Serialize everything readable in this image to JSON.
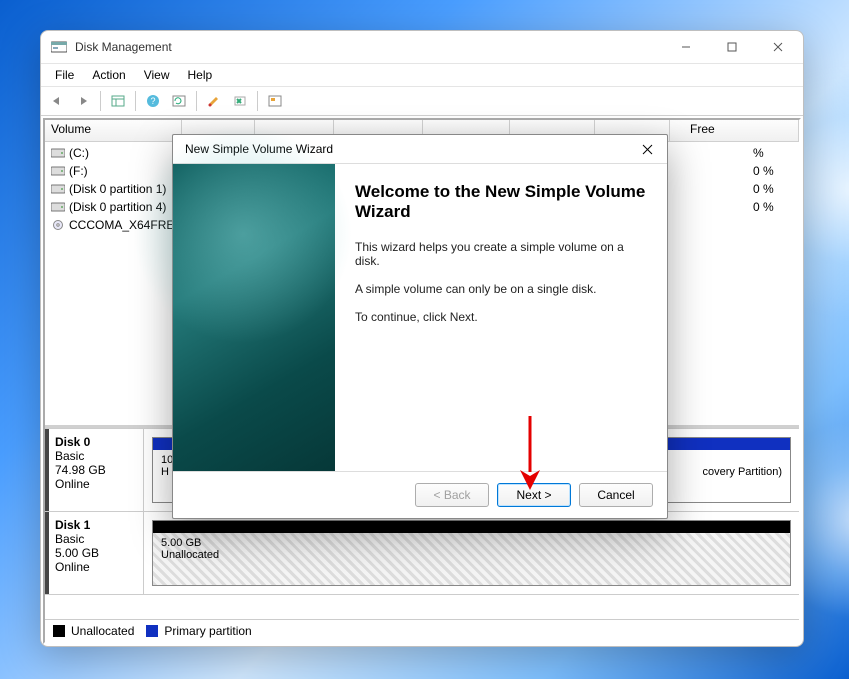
{
  "window": {
    "title": "Disk Management",
    "menu": [
      "File",
      "Action",
      "View",
      "Help"
    ]
  },
  "columns": {
    "volume": "Volume",
    "free": "Free"
  },
  "volumes": [
    {
      "label": "(C:)",
      "icon": "drive"
    },
    {
      "label": "(F:)",
      "icon": "drive"
    },
    {
      "label": "(Disk 0 partition 1)",
      "icon": "drive"
    },
    {
      "label": "(Disk 0 partition 4)",
      "icon": "drive"
    },
    {
      "label": "CCCOMA_X64FRE...",
      "icon": "disc"
    }
  ],
  "free_tail": [
    "%",
    "0 %",
    "0 %",
    "0 %",
    ""
  ],
  "disks": [
    {
      "name": "Disk 0",
      "type": "Basic",
      "size": "74.98 GB",
      "status": "Online"
    },
    {
      "name": "Disk 1",
      "type": "Basic",
      "size": "5.00 GB",
      "status": "Online"
    }
  ],
  "disk1_part": {
    "size": "5.00 GB",
    "label": "Unallocated"
  },
  "disk0_hint": "10",
  "disk0_tail": "covery Partition)",
  "legend": {
    "unalloc": "Unallocated",
    "primary": "Primary partition"
  },
  "dialog": {
    "title": "New Simple Volume Wizard",
    "heading": "Welcome to the New Simple Volume Wizard",
    "line1": "This wizard helps you create a simple volume on a disk.",
    "line2": "A simple volume can only be on a single disk.",
    "line3": "To continue, click Next.",
    "back": "< Back",
    "next": "Next >",
    "cancel": "Cancel"
  }
}
